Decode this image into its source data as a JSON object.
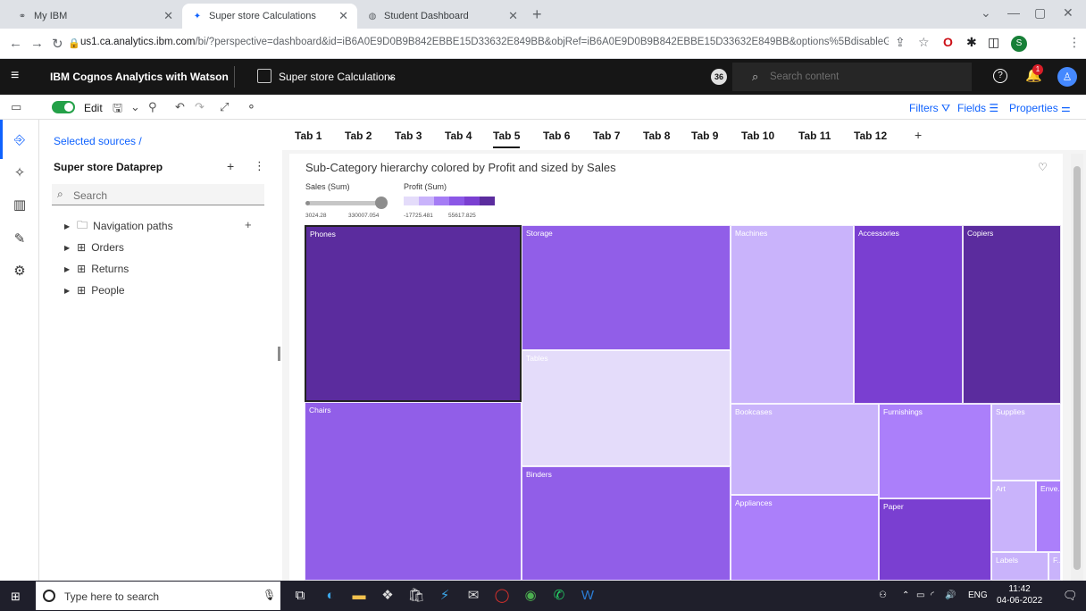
{
  "browser": {
    "tabs": [
      {
        "title": "My IBM",
        "active": false
      },
      {
        "title": "Super store Calculations",
        "active": true
      },
      {
        "title": "Student Dashboard",
        "active": false
      }
    ],
    "url_host": "us1.ca.analytics.ibm.com",
    "url_path": "/bi/?perspective=dashboard&id=iB6A0E9D0B9B842EBBE15D33632E849BB&objRef=iB6A0E9D0B9B842EBBE15D33632E849BB&options%5BdisableGlassPrefetch..."
  },
  "app_header": {
    "brand": "IBM Cognos Analytics with Watson",
    "dashboard_name": "Super store Calculations",
    "notification_count": "36",
    "search_placeholder": "Search content",
    "bell_badge": "1"
  },
  "toolbar": {
    "edit_label": "Edit",
    "filters_label": "Filters",
    "fields_label": "Fields",
    "properties_label": "Properties"
  },
  "sources": {
    "breadcrumb": "Selected sources  /",
    "datasource": "Super store Dataprep",
    "search_placeholder": "Search",
    "tree": [
      "Navigation paths",
      "Orders",
      "Returns",
      "People"
    ]
  },
  "dashboard_tabs": [
    "Tab 1",
    "Tab 2",
    "Tab 3",
    "Tab 4",
    "Tab 5",
    "Tab 6",
    "Tab 7",
    "Tab 8",
    "Tab 9",
    "Tab 10",
    "Tab 11",
    "Tab 12"
  ],
  "active_tab": "Tab 5",
  "widget": {
    "title": "Sub-Category hierarchy colored by Profit and sized by Sales",
    "size_legend_label": "Sales (Sum)",
    "size_legend_min": "3024.28",
    "size_legend_max": "330007.054",
    "color_legend_label": "Profit (Sum)",
    "color_legend_min": "-17725.481",
    "color_legend_max": "55617.825",
    "color_scale": [
      "#e4dcfa",
      "#c9b3fb",
      "#a57cf5",
      "#8b57e6",
      "#7a3fd1",
      "#5b2c9e"
    ]
  },
  "chart_data": {
    "type": "treemap",
    "title": "Sub-Category hierarchy colored by Profit and sized by Sales",
    "size_measure": "Sales (Sum)",
    "color_measure": "Profit (Sum)",
    "size_range": [
      3024.28,
      330007.054
    ],
    "color_range": [
      -17725.481,
      55617.825
    ],
    "items": [
      {
        "name": "Phones",
        "color": "#5b2c9e"
      },
      {
        "name": "Chairs",
        "color": "#915ee8"
      },
      {
        "name": "Storage",
        "color": "#915ee8"
      },
      {
        "name": "Tables",
        "color": "#e4dcfa"
      },
      {
        "name": "Binders",
        "color": "#915ee8"
      },
      {
        "name": "Machines",
        "color": "#c9b3fb"
      },
      {
        "name": "Accessories",
        "color": "#7a3fd1"
      },
      {
        "name": "Copiers",
        "color": "#5b2c9e"
      },
      {
        "name": "Bookcases",
        "color": "#c9b3fb"
      },
      {
        "name": "Appliances",
        "color": "#ab7ffa"
      },
      {
        "name": "Furnishings",
        "color": "#ab7ffa"
      },
      {
        "name": "Paper",
        "color": "#7a3fd1"
      },
      {
        "name": "Supplies",
        "color": "#c9b3fb"
      },
      {
        "name": "Art",
        "color": "#c9b3fb"
      },
      {
        "name": "Envelopes",
        "label": "Enve...",
        "color": "#ab7ffa"
      },
      {
        "name": "Labels",
        "color": "#c9b3fb"
      },
      {
        "name": "Fasteners",
        "label": "F...",
        "color": "#c9b3fb"
      }
    ]
  },
  "taskbar": {
    "search_placeholder": "Type here to search",
    "lang": "ENG",
    "time": "11:42",
    "date": "04-06-2022"
  }
}
